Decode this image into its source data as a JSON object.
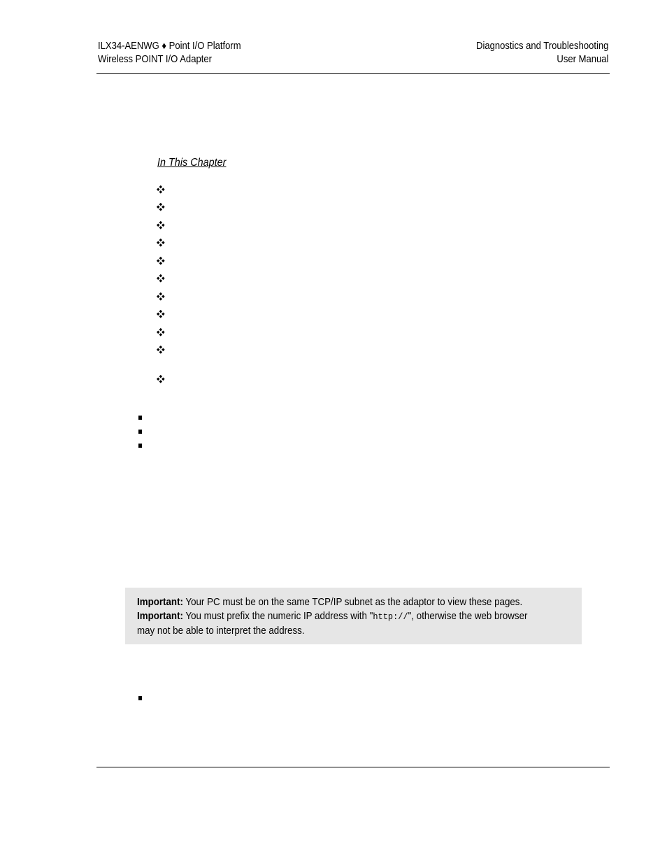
{
  "header": {
    "left_line1": "ILX34-AENWG ♦ Point I/O Platform",
    "left_line2": "Wireless POINT I/O Adapter",
    "right_line1": "Diagnostics and Troubleshooting",
    "right_line2": "User Manual"
  },
  "chapter": {
    "title": "In This Chapter",
    "items": [
      "",
      "",
      "",
      "",
      "",
      "",
      "",
      "",
      "",
      "",
      ""
    ]
  },
  "bullets_group1": [
    "",
    "",
    ""
  ],
  "important_box": {
    "line1_label": "Important:",
    "line1_text": " Your PC must be on the same TCP/IP subnet as the adaptor to view these pages.",
    "line2_label": "Important:",
    "line2_text_before": " You must prefix the numeric IP address with \"",
    "line2_code": "http://",
    "line2_text_after": "\", otherwise the web browser",
    "line3_text": "may not be able to interpret the address."
  },
  "bullets_group2": [
    ""
  ]
}
